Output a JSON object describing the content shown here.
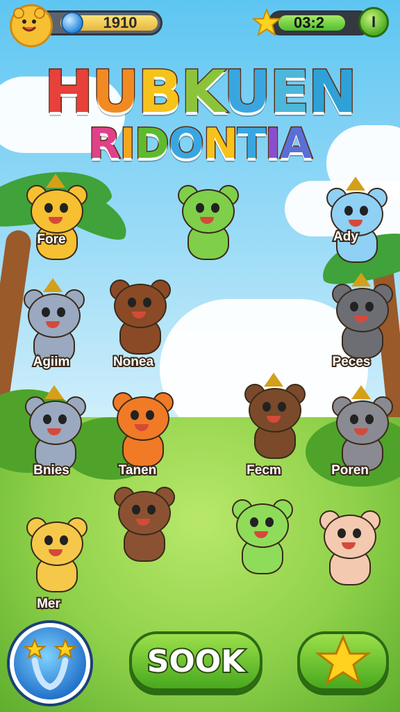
{
  "hud": {
    "coins": "1910",
    "timer": "03:2",
    "pause_label": "I"
  },
  "title": {
    "line1": [
      "H",
      "U",
      "B",
      "K",
      "U",
      "E",
      "N"
    ],
    "line1_colors": [
      "#e8403a",
      "#f28a23",
      "#f6c21c",
      "#8bc43a",
      "#3aa6e0",
      "#4cb7d8",
      "#2fa1d6"
    ],
    "line2": [
      "R",
      "I",
      "D",
      "O",
      "N",
      "T",
      "I",
      "A"
    ],
    "line2_colors": [
      "#e2408a",
      "#f6a51c",
      "#5dbb2f",
      "#3aa6e0",
      "#f6c21c",
      "#3aa6e0",
      "#8b4dd0",
      "#5a6fd6"
    ]
  },
  "characters": [
    {
      "label": "Fore"
    },
    {
      "label": "Ady"
    },
    {
      "label": "Agiim"
    },
    {
      "label": "Nonea"
    },
    {
      "label": "Peces"
    },
    {
      "label": "Bnies"
    },
    {
      "label": "Tanen"
    },
    {
      "label": "Fecm"
    },
    {
      "label": "Poren"
    },
    {
      "label": "Mer"
    }
  ],
  "buttons": {
    "primary": "SOOK"
  },
  "icons": {
    "coin": "gem-icon",
    "timer": "star-icon",
    "pause": "pause-icon",
    "special": "magic-stars-icon",
    "favorite": "star-icon"
  },
  "colors": {
    "sky": "#5ec6f2",
    "grass": "#8fd14a",
    "button_green": "#48a81e"
  }
}
